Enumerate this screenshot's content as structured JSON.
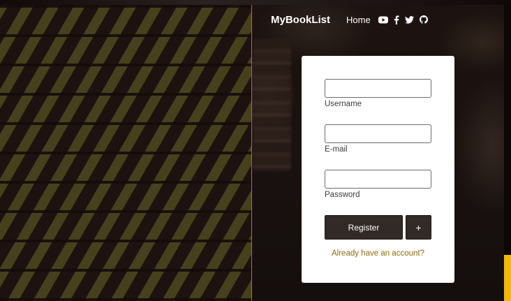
{
  "nav": {
    "brand": "MyBookList",
    "home": "Home",
    "icons": [
      "youtube-icon",
      "facebook-icon",
      "twitter-icon",
      "github-icon"
    ]
  },
  "form": {
    "username": {
      "label": "Username",
      "value": ""
    },
    "email": {
      "label": "E-mail",
      "value": ""
    },
    "password": {
      "label": "Password",
      "value": ""
    },
    "register_label": "Register",
    "plus_label": "+",
    "login_link": "Already have an account?"
  },
  "colors": {
    "accent": "#f5b800",
    "button": "#322a26",
    "link": "#8e6a10"
  }
}
